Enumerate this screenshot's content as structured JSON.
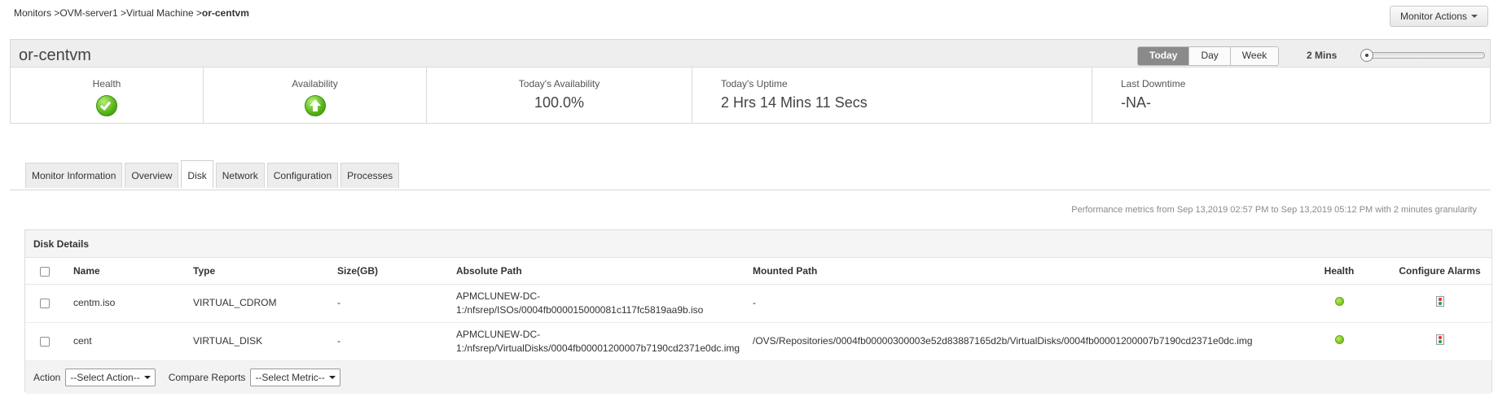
{
  "breadcrumb": {
    "items": [
      "Monitors >",
      "OVM-server1 >",
      "Virtual Machine >"
    ],
    "current": "or-centvm"
  },
  "monitor_actions_label": "Monitor Actions",
  "header": {
    "title": "or-centvm",
    "periods": [
      "Today",
      "Day",
      "Week"
    ],
    "active_period": "Today",
    "interval": "2 Mins",
    "slider_level": 0
  },
  "stats": {
    "health_label": "Health",
    "availability_label": "Availability",
    "todays_availability_label": "Today's Availability",
    "todays_availability_value": "100.0%",
    "todays_uptime_label": "Today's Uptime",
    "todays_uptime_value": "2 Hrs 14 Mins 11 Secs",
    "last_downtime_label": "Last Downtime",
    "last_downtime_value": "-NA-"
  },
  "tabs": [
    "Monitor Information",
    "Overview",
    "Disk",
    "Network",
    "Configuration",
    "Processes"
  ],
  "active_tab": "Disk",
  "perf_note": "Performance metrics from Sep 13,2019 02:57 PM to Sep 13,2019 05:12 PM with 2 minutes granularity",
  "disk": {
    "title": "Disk Details",
    "columns": [
      "Name",
      "Type",
      "Size(GB)",
      "Absolute Path",
      "Mounted Path",
      "Health",
      "Configure Alarms"
    ],
    "rows": [
      {
        "name": "centm.iso",
        "type": "VIRTUAL_CDROM",
        "size": "-",
        "absolute_path_1": "APMCLUNEW-DC-",
        "absolute_path_2": "1:/nfsrep/ISOs/0004fb000015000081c117fc5819aa9b.iso",
        "mounted_path": "-"
      },
      {
        "name": "cent",
        "type": "VIRTUAL_DISK",
        "size": "-",
        "absolute_path_1": "APMCLUNEW-DC-",
        "absolute_path_2": "1:/nfsrep/VirtualDisks/0004fb00001200007b7190cd2371e0dc.img",
        "mounted_path": "/OVS/Repositories/0004fb00000300003e52d83887165d2b/VirtualDisks/0004fb00001200007b7190cd2371e0dc.img"
      }
    ],
    "action_label": "Action",
    "action_select": "--Select Action--",
    "compare_label": "Compare Reports",
    "compare_select": "--Select Metric--"
  },
  "colors": {
    "health_ok": "#7cc31d",
    "active_period_bg": "#8a8a8a"
  }
}
